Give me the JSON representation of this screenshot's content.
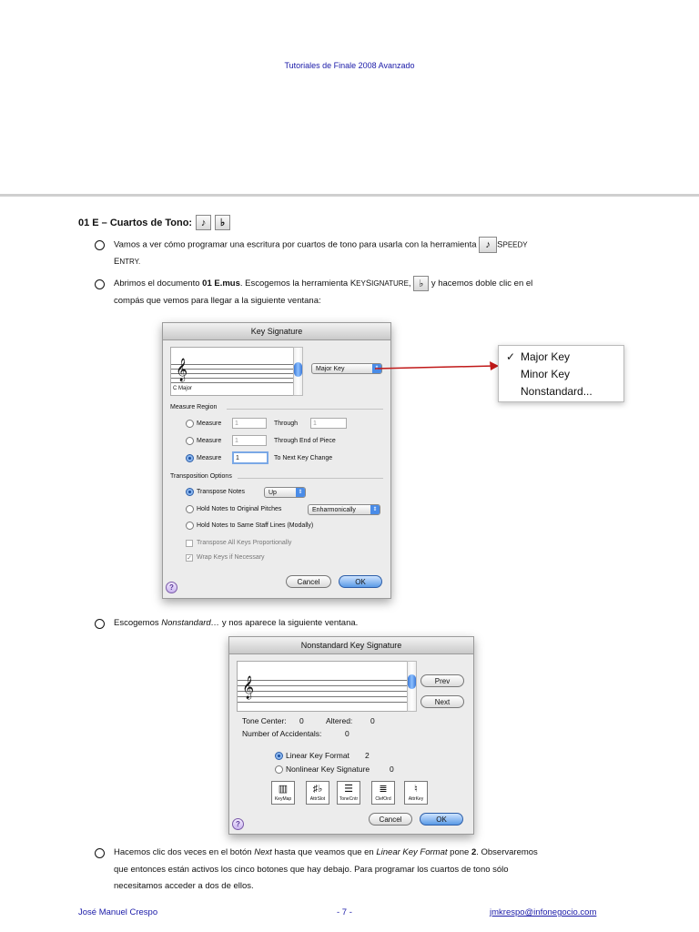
{
  "header": {
    "title": "Tutoriales de Finale 2008 Avanzado"
  },
  "section": {
    "title": "01 E – Cuartos de Tono:",
    "icon_a": "speedy-entry-icon",
    "icon_b": "key-signature-icon"
  },
  "para1": {
    "text": "Vamos a ver cómo programar una escritura por cuartos de tono para usarla con la herramienta",
    "tool_first": "S",
    "tool_rest": "PEEDY",
    "line2_first": "E",
    "line2_rest": "NTRY."
  },
  "para2": {
    "a": "Abrimos el documento ",
    "b": "01 E.mus",
    "c": ". Escogemos la herramienta ",
    "tool_k": "K",
    "tool_ey": "EY",
    "tool_s": "S",
    "tool_ignature": "IGNATURE",
    "d": ",",
    "e": " y hacemos doble clic en el",
    "line2": "compás que vemos para llegar a la siguiente ventana:"
  },
  "key_dialog": {
    "title": "Key Signature",
    "staff_caption": "C Major",
    "key_popup": "Major Key",
    "measure_region_label": "Measure Region",
    "rows": [
      {
        "radio_label": "Measure",
        "from": "1",
        "mid_label": "Through",
        "to": "1"
      },
      {
        "radio_label": "Measure",
        "from": "1",
        "mid_label": "Through End of Piece"
      },
      {
        "radio_label": "Measure",
        "from": "1",
        "mid_label": "To Next Key Change"
      }
    ],
    "transposition_label": "Transposition Options",
    "transpose_notes": "Transpose Notes",
    "transpose_dir": "Up",
    "hold_original": "Hold Notes to Original Pitches",
    "enharm": "Enharmonically",
    "hold_staff": "Hold Notes to Same Staff Lines (Modally)",
    "transpose_all": "Transpose All Keys Proportionally",
    "wrap_keys": "Wrap Keys if Necessary",
    "cancel": "Cancel",
    "ok": "OK",
    "help": "?"
  },
  "key_menu": {
    "check": "✓",
    "items": [
      "Major Key",
      "Minor Key",
      "Nonstandard..."
    ]
  },
  "para3": {
    "a": "Escogemos ",
    "b": "Nonstandard…",
    "c": " y nos aparece la siguiente ventana."
  },
  "nonstd_dialog": {
    "title": "Nonstandard Key Signature",
    "prev": "Prev",
    "next": "Next",
    "tone_center_label": "Tone Center:",
    "tone_center": "0",
    "altered_label": "Altered:",
    "altered": "0",
    "num_acc_label": "Number of Accidentals:",
    "num_acc": "0",
    "linear_label": "Linear Key Format",
    "linear_value": "2",
    "nonlinear_label": "Nonlinear Key Signature",
    "nonlinear_value": "0",
    "tools": [
      "KeyMap",
      "AttrSlot",
      "ToneCntr",
      "ClefOrd",
      "AttrKey"
    ],
    "cancel": "Cancel",
    "ok": "OK",
    "help": "?"
  },
  "para4": {
    "a": "Hacemos clic dos veces en el botón ",
    "b": "Next",
    "c": " hasta que veamos que en ",
    "d": "Linear Key Format",
    "e": " pone ",
    "f": "2",
    "g": ". Observaremos",
    "line2": "que entonces están activos los cinco botones que hay debajo. Para programar los cuartos de tono sólo",
    "line3": "necesitamos acceder a dos de ellos."
  },
  "footer": {
    "author": "José Manuel Crespo",
    "page": "- 7 -",
    "email": "jmkrespo@infonegocio.com"
  },
  "colors": {
    "header_blue": "#1a1aa8",
    "arrow_red": "#c01818",
    "ok_blue": "#5a9ae6"
  }
}
